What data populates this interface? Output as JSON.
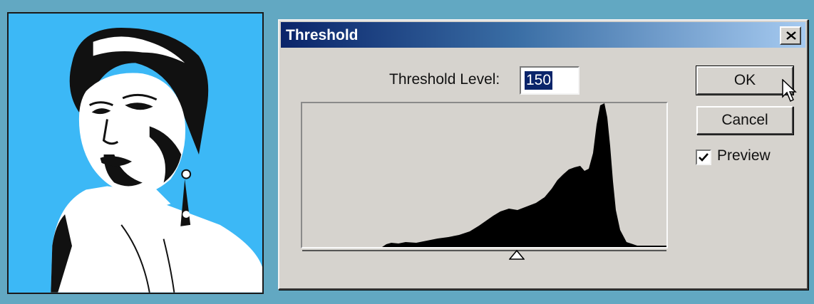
{
  "dialog": {
    "title": "Threshold",
    "threshold_level_label": "Threshold Level:",
    "threshold_level_value": "150",
    "ok_label": "OK",
    "cancel_label": "Cancel",
    "preview_label": "Preview",
    "preview_checked": true
  },
  "histogram": {
    "slider_value": 150,
    "slider_max": 255,
    "peak_level": 208
  },
  "colors": {
    "background": "#62a8c2",
    "photo_background": "#3cb8f6",
    "dialog_face": "#d6d3ce",
    "title_start": "#0a246a",
    "title_end": "#a6caf0",
    "selection": "#0a246a"
  },
  "icons": {
    "close": "close-icon",
    "checkbox": "checkmark-icon",
    "slider": "triangle-slider-icon",
    "cursor": "mouse-pointer-icon"
  }
}
